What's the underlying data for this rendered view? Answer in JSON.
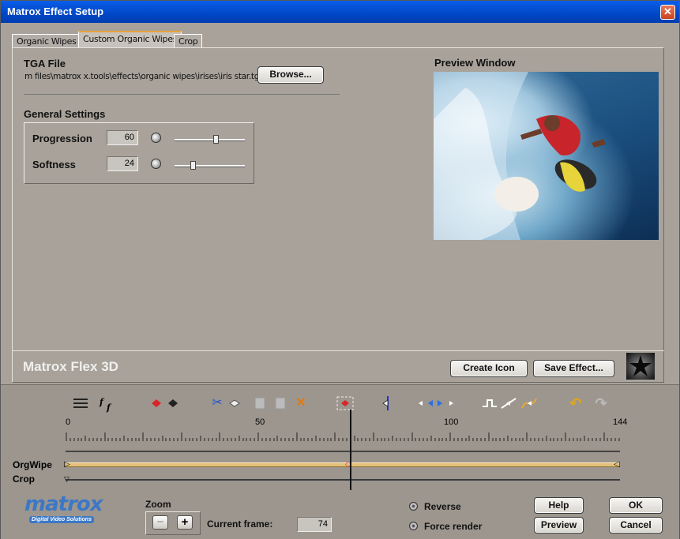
{
  "window": {
    "title": "Matrox Effect Setup",
    "close_glyph": "✕"
  },
  "tabs": [
    {
      "label": "Organic Wipes",
      "active": false
    },
    {
      "label": "Custom Organic Wipes",
      "active": true
    },
    {
      "label": "Crop",
      "active": false
    }
  ],
  "tga": {
    "heading": "TGA File",
    "path": "m files\\matrox x.tools\\effects\\organic wipes\\irises\\iris star.tga",
    "browse_label": "Browse..."
  },
  "general_settings": {
    "heading": "General Settings",
    "progression": {
      "label": "Progression",
      "value": "60",
      "level": 0.6
    },
    "softness": {
      "label": "Softness",
      "value": "24",
      "level": 0.24
    }
  },
  "preview": {
    "heading": "Preview Window"
  },
  "flex": {
    "title": "Matrox Flex 3D",
    "create_icon_label": "Create Icon",
    "save_effect_label": "Save Effect..."
  },
  "timeline": {
    "ruler_labels": [
      "0",
      "50",
      "100",
      "144"
    ],
    "ruler_max": 144,
    "current_frame_value": 74,
    "tracks": [
      {
        "label": "OrgWipe"
      },
      {
        "label": "Crop"
      }
    ],
    "toolbar_icons": [
      "menu-lines-icon",
      "keyframe-format-icon",
      "add-key-icon",
      "add-key-black-icon",
      "cut-icon",
      "copy-key-icon",
      "paste-icon",
      "paste-disabled-icon",
      "delete-icon",
      "select-range-icon",
      "go-to-key-icon",
      "prev-next-key-icon",
      "linear-key-icon",
      "curve-key-icon",
      "bezier-key-icon",
      "undo-icon",
      "redo-icon"
    ]
  },
  "zoom": {
    "label": "Zoom",
    "minus": "−",
    "plus": "+"
  },
  "current_frame": {
    "label": "Current frame:",
    "value": "74"
  },
  "options": {
    "reverse_label": "Reverse",
    "force_render_label": "Force render"
  },
  "buttons": {
    "help": "Help",
    "ok": "OK",
    "preview": "Preview",
    "cancel": "Cancel"
  },
  "logo": {
    "name": "matrox",
    "tagline": "Digital Video Solutions"
  },
  "colors": {
    "title_bar": "#0047c6",
    "track_orgwipe": "#e3c07a",
    "accent_tab": "#e8a33a"
  }
}
